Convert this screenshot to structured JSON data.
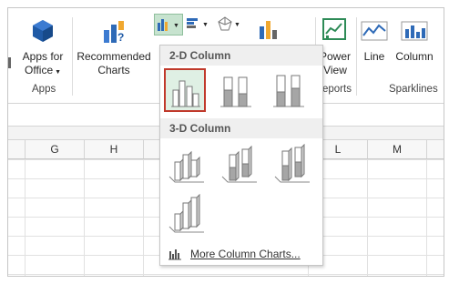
{
  "ribbon": {
    "apps_for_office_label": "Apps for",
    "apps_for_office_label2": "Office",
    "recommended_charts_label": "Recommended",
    "recommended_charts_label2": "Charts",
    "power_view_label": "Power",
    "power_view_label2": "View",
    "line_label": "Line",
    "column_label": "Column",
    "apps_group": "Apps",
    "reports_group": "eports",
    "sparklines_group": "Sparklines"
  },
  "columns": [
    "G",
    "H",
    "L",
    "M"
  ],
  "dropdown": {
    "section_2d": "2-D Column",
    "section_3d": "3-D Column",
    "more_label": "More Column Charts..."
  },
  "colors": {
    "selected_border": "#c0392b",
    "selected_fill": "#dff0e4",
    "accent": "#217346"
  }
}
